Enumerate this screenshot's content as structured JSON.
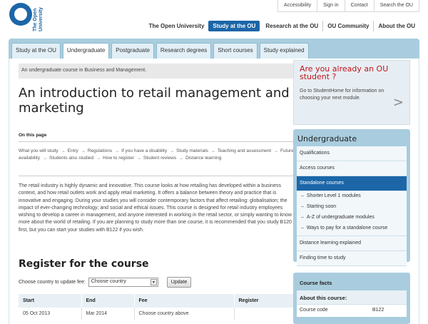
{
  "logo": {
    "line1": "The Open",
    "line2": "University"
  },
  "utility_nav": [
    "Accessibility",
    "Sign in",
    "Contact",
    "Search the OU"
  ],
  "main_nav": [
    "The Open University",
    "Study at the OU",
    "Research at the OU",
    "OU Community",
    "About the OU"
  ],
  "main_nav_active": "Study at the OU",
  "tabs": [
    "Study at the OU",
    "Undergraduate",
    "Postgraduate",
    "Research degrees",
    "Short courses",
    "Study explained"
  ],
  "active_tab": "Undergraduate",
  "breadcrumb": "An undergraduate course in Business and Management.",
  "page_title": "An introduction to retail management and marketing",
  "on_this_page": "On this page",
  "toc": [
    "What you will study",
    "Entry",
    "Regulations",
    "If you have a disability",
    "Study materials",
    "Teaching and assessment",
    "Future availability",
    "Students also studied",
    "How to register",
    "Student reviews",
    "Distance learning"
  ],
  "intro": "The retail industry is highly dynamic and innovative. This course looks at how retailing has developed within a business context, and how retail outlets work and apply retail marketing. It offers a balance between theory and practice that is innovative and engaging. During your studies you will consider contemporary factors that affect retailing: globalisation; the impact of ever-changing technology; and social and ethical issues. This course is designed for retail industry employees wishing to develop a career in management, and anyone interested in working in the retail sector, or simply wanting to know more about the world of retailing.  If you are planning to study more than one course, it is recommended that you study B120 first, but you can start your studies with B122 if you wish.",
  "register": {
    "title": "Register for the course",
    "country_label": "Choose country to update fee:",
    "country_value": "Choose country",
    "update_label": "Update",
    "headers": [
      "Start",
      "End",
      "Fee",
      "Register"
    ],
    "rows": [
      [
        "05 Oct 2013",
        "Mar 2014",
        "Choose country above",
        ""
      ]
    ]
  },
  "sidebar_box": {
    "heading": "Are you already an OU student ?",
    "text": "Go to StudentHome for information on choosing your next module."
  },
  "side_nav": {
    "heading": "Undergraduate",
    "items_top": [
      "Qualifications",
      "Access courses"
    ],
    "active": "Standalone courses",
    "sub_items": [
      "Shorter Level 1 modules",
      "Starting soon",
      "A-Z of undergraduate modules",
      "Ways to pay for a standalone course"
    ],
    "items_bottom": [
      "Distance learning explained",
      "Finding time to study"
    ]
  },
  "course_facts": {
    "heading": "Course facts",
    "subheading": "About this course:",
    "rows": [
      {
        "label": "Course code",
        "value": "B122"
      }
    ]
  },
  "colors": {
    "brand_blue": "#1c66a8",
    "tab_bar": "#a9cdde",
    "alert_red": "#c0141b"
  }
}
